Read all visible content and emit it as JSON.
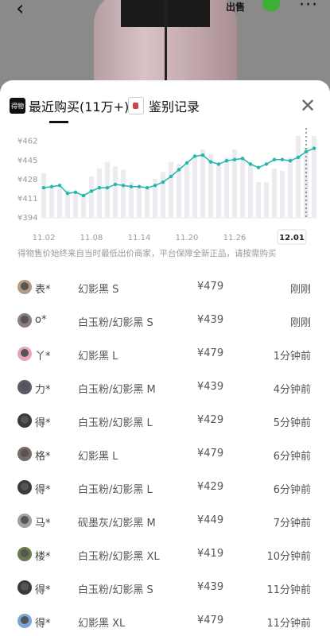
{
  "header": {
    "sell_label": "出售",
    "icons": [
      "back-icon",
      "wechat-icon",
      "more-icon"
    ]
  },
  "tabs": [
    {
      "logo": "得物",
      "label": "最近购买(11万+)"
    },
    {
      "label": "鉴别记录"
    }
  ],
  "chart_data": {
    "type": "bar",
    "accent": "#21b8ac",
    "bar_color": "#ececf0",
    "y_ticks": [
      "¥462",
      "¥445",
      "¥428",
      "¥411",
      "¥394"
    ],
    "y_values": [
      462,
      445,
      428,
      411,
      394
    ],
    "ylim": [
      394,
      466
    ],
    "x_tick_labels": [
      "11.02",
      "11.08",
      "11.14",
      "11.20",
      "11.26",
      "12.01"
    ],
    "line_values": [
      420,
      421,
      422,
      415,
      416,
      413,
      417,
      420,
      420,
      423,
      422,
      421,
      421,
      420,
      422,
      425,
      430,
      436,
      442,
      448,
      449,
      443,
      441,
      444,
      445,
      446,
      441,
      438,
      441,
      445,
      445,
      444,
      447,
      452,
      455
    ],
    "bar_values": [
      433,
      420,
      419,
      418,
      416,
      415,
      430,
      437,
      443,
      439,
      436,
      425,
      420,
      419,
      428,
      434,
      443,
      441,
      440,
      448,
      454,
      450,
      441,
      447,
      454,
      447,
      441,
      425,
      425,
      437,
      435,
      447,
      466,
      456,
      466
    ]
  },
  "disclaimer": "得物售价始终来自当时最低出价商家，平台保障全新正品，请按需购买",
  "purchases": [
    {
      "user": "表*",
      "spec": "幻影黑 S",
      "price": "¥479",
      "time": "刚刚",
      "avatar_color": "#b49a80"
    },
    {
      "user": "o*",
      "spec": "白玉粉/幻影黑 S",
      "price": "¥439",
      "time": "刚刚",
      "avatar_color": "#8e7a88"
    },
    {
      "user": "丫*",
      "spec": "幻影黑 L",
      "price": "¥479",
      "time": "1分钟前",
      "avatar_color": "#e9a6b8"
    },
    {
      "user": "力*",
      "spec": "白玉粉/幻影黑 M",
      "price": "¥439",
      "time": "4分钟前",
      "avatar_color": "#5a5a6a"
    },
    {
      "user": "得*",
      "spec": "白玉粉/幻影黑 L",
      "price": "¥429",
      "time": "5分钟前",
      "avatar_color": "#3a3a3a"
    },
    {
      "user": "格*",
      "spec": "幻影黑 L",
      "price": "¥479",
      "time": "6分钟前",
      "avatar_color": "#7a6a66"
    },
    {
      "user": "得*",
      "spec": "白玉粉/幻影黑 L",
      "price": "¥429",
      "time": "6分钟前",
      "avatar_color": "#3a3a3a"
    },
    {
      "user": "马*",
      "spec": "砚墨灰/幻影黑 M",
      "price": "¥449",
      "time": "7分钟前",
      "avatar_color": "#9aa0a8"
    },
    {
      "user": "楼*",
      "spec": "白玉粉/幻影黑 XL",
      "price": "¥419",
      "time": "10分钟前",
      "avatar_color": "#6a7a4a"
    },
    {
      "user": "得*",
      "spec": "白玉粉/幻影黑 S",
      "price": "¥439",
      "time": "11分钟前",
      "avatar_color": "#3a3a3a"
    },
    {
      "user": "得*",
      "spec": "幻影黑 XL",
      "price": "¥479",
      "time": "11分钟前",
      "avatar_color": "#7aa6d8"
    }
  ]
}
